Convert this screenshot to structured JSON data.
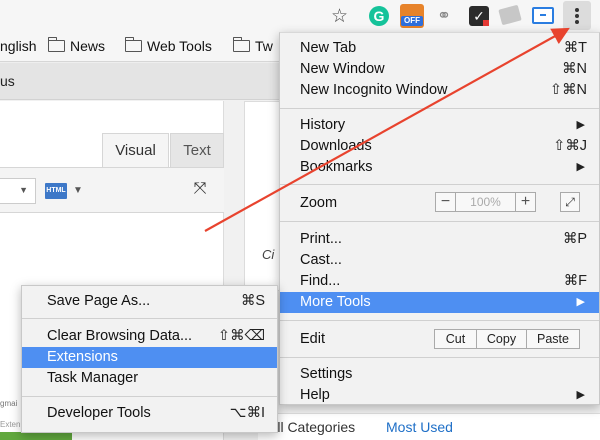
{
  "toolbar": {
    "star_glyph": "☆",
    "extensions": [
      {
        "icon": "grammarly-icon",
        "glyph": "G"
      },
      {
        "icon": "coupon-off-icon",
        "badge": "OFF"
      },
      {
        "icon": "link-icon",
        "glyph": "⚭"
      },
      {
        "icon": "checklist-icon",
        "glyph": "✓"
      },
      {
        "icon": "mail-icon"
      },
      {
        "icon": "cast-icon"
      }
    ],
    "menu_button_icon": "kebab-menu-icon"
  },
  "bookmarks": {
    "items": [
      {
        "label": "nglish",
        "folder": false
      },
      {
        "label": "News",
        "folder": true
      },
      {
        "label": "Web Tools",
        "folder": true
      },
      {
        "label": "Tw",
        "folder": true
      }
    ]
  },
  "page": {
    "subbar_text": "us",
    "tabs": {
      "visual": "Visual",
      "text": "Text"
    },
    "html_button": "HTML",
    "right_card_text": "Ci",
    "gmail_text": "gmai",
    "exten_text": "Exten",
    "category_tabs": [
      "All Categories",
      "Most Used"
    ]
  },
  "menu": {
    "items": [
      {
        "label": "New Tab",
        "shortcut": "⌘T"
      },
      {
        "label": "New Window",
        "shortcut": "⌘N"
      },
      {
        "label": "New Incognito Window",
        "shortcut": "⇧⌘N"
      },
      {
        "label": "History",
        "arrow": "▶"
      },
      {
        "label": "Downloads",
        "shortcut": "⇧⌘J"
      },
      {
        "label": "Bookmarks",
        "arrow": "▶"
      },
      {
        "label": "Zoom"
      },
      {
        "label": "Print...",
        "shortcut": "⌘P"
      },
      {
        "label": "Cast..."
      },
      {
        "label": "Find...",
        "shortcut": "⌘F"
      },
      {
        "label": "More Tools",
        "arrow": "▶",
        "highlighted": true
      },
      {
        "label": "Edit"
      },
      {
        "label": "Settings"
      },
      {
        "label": "Help",
        "arrow": "▶"
      }
    ],
    "zoom": {
      "minus": "−",
      "value": "100%",
      "plus": "+",
      "fullscreen_icon": "fullscreen-icon"
    },
    "edit": {
      "cut": "Cut",
      "copy": "Copy",
      "paste": "Paste"
    }
  },
  "submenu": {
    "items": [
      {
        "label": "Save Page As...",
        "shortcut": "⌘S"
      },
      {
        "label": "Clear Browsing Data...",
        "shortcut": "⇧⌘⌫"
      },
      {
        "label": "Extensions",
        "highlighted": true
      },
      {
        "label": "Task Manager"
      },
      {
        "label": "Developer Tools",
        "shortcut": "⌥⌘I"
      }
    ]
  },
  "colors": {
    "highlight": "#4e8ff2",
    "annotation_arrow": "#e8432e",
    "menu_background": "#f2f2f2"
  }
}
